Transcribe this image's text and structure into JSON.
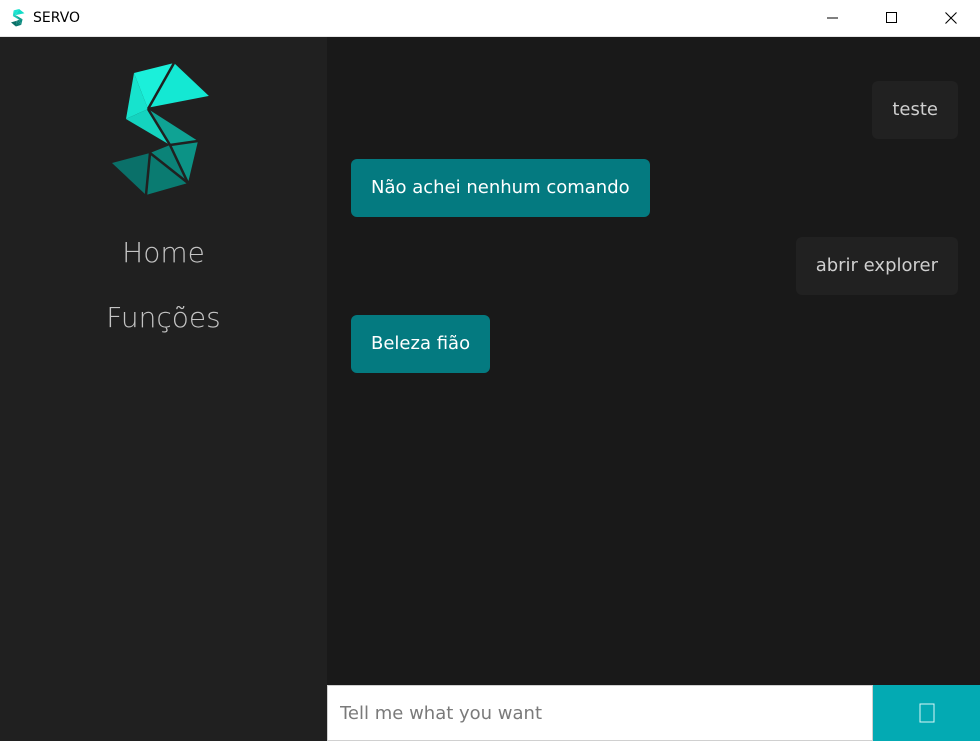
{
  "window": {
    "title": "SERVO",
    "icon": "servo-logo-icon"
  },
  "sidebar": {
    "logo": "servo-logo-icon",
    "items": [
      {
        "label": "Home"
      },
      {
        "label": "Funções"
      }
    ]
  },
  "chat": {
    "messages": [
      {
        "sender": "user",
        "text": "teste"
      },
      {
        "sender": "bot",
        "text": "Não achei nenhum comando"
      },
      {
        "sender": "user",
        "text": "abrir explorer"
      },
      {
        "sender": "bot",
        "text": "Beleza fião"
      }
    ]
  },
  "input": {
    "placeholder": "Tell me what you want",
    "value": ""
  },
  "send_button": {
    "icon": "send-icon"
  },
  "colors": {
    "sidebar_bg": "#202020",
    "chat_bg": "#191919",
    "bot_bubble": "#047a80",
    "user_bubble": "#212121",
    "send_button": "#03aab3",
    "logo_accent": "#1de9d0"
  }
}
